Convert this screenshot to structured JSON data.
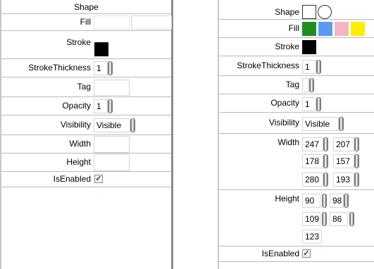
{
  "left_panel": {
    "title": "Shape",
    "fill_label": "Fill",
    "stroke_label": "Stroke",
    "stroke_color": "#000000",
    "stroke_thickness_label": "StrokeThickness",
    "stroke_thickness_value": "1",
    "tag_label": "Tag",
    "tag_value": "",
    "opacity_label": "Opacity",
    "opacity_value": "1",
    "visibility_label": "Visibility",
    "visibility_value": "Visible",
    "width_label": "Width",
    "width_value": "",
    "height_label": "Height",
    "height_value": "",
    "isenabled_label": "IsEnabled",
    "isenabled_checked": true
  },
  "right_panel": {
    "shape_label": "Shape",
    "shape_icons": [
      "square-icon",
      "circle-icon"
    ],
    "fill_label": "Fill",
    "fill_colors": [
      "#1e8e1e",
      "#5b9bef",
      "#f4b6c2",
      "#ffee00"
    ],
    "stroke_label": "Stroke",
    "stroke_color": "#000000",
    "stroke_thickness_label": "StrokeThickness",
    "stroke_thickness_value": "1",
    "tag_label": "Tag",
    "tag_value": "",
    "opacity_label": "Opacity",
    "opacity_value": "1",
    "visibility_label": "Visibility",
    "visibility_value": "Visible",
    "width_label": "Width",
    "width_values": [
      "247",
      "207",
      "178",
      "157",
      "280",
      "193"
    ],
    "height_label": "Height",
    "height_values": [
      "90",
      "98",
      "109",
      "86",
      "123"
    ],
    "isenabled_label": "IsEnabled",
    "isenabled_checked": true
  }
}
